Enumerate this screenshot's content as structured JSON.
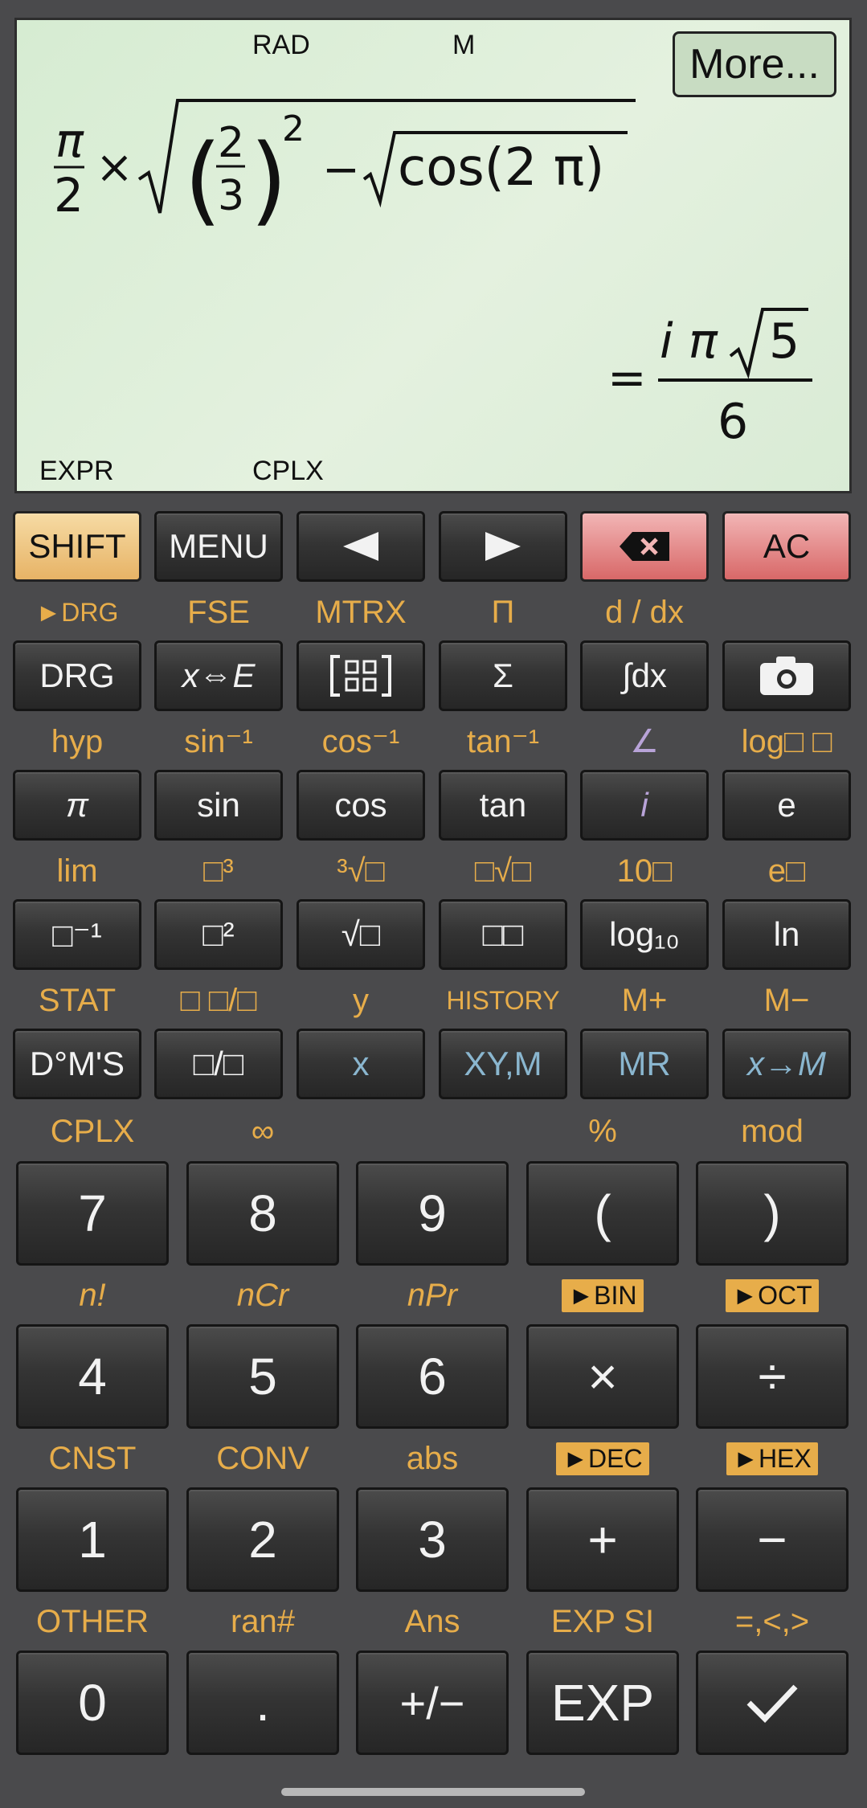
{
  "display": {
    "indicators": {
      "rad": "RAD",
      "m": "M",
      "expr": "EXPR",
      "cplx": "CPLX"
    },
    "more_button": "More...",
    "expression": {
      "pi": "π",
      "two": "2",
      "times": "×",
      "two_num": "2",
      "three_den": "3",
      "exponent": "2",
      "minus": "−",
      "cos_text": "cos(2 π)"
    },
    "result": {
      "equals": "=",
      "numerator": "i π",
      "radicand": "5",
      "denominator": "6"
    }
  },
  "keys": {
    "row1": [
      "SHIFT",
      "MENU",
      "◀",
      "▶",
      "⌫",
      "AC"
    ],
    "row1_icons": [
      "",
      "",
      "left-arrow-icon",
      "right-arrow-icon",
      "backspace-icon",
      ""
    ],
    "row2": [
      "DRG",
      "x⇔E",
      "[⊞]",
      "Σ",
      "∫dx",
      "📷"
    ],
    "row3": [
      "π",
      "sin",
      "cos",
      "tan",
      "i",
      "e"
    ],
    "row4": [
      "□⁻¹",
      "□²",
      "√□",
      "□□",
      "log₁₀",
      "ln"
    ],
    "row5": [
      "D°M'S",
      "□/□",
      "x",
      "XY,M",
      "MR",
      "x→M"
    ],
    "row6": [
      "7",
      "8",
      "9",
      "(",
      ")"
    ],
    "row7": [
      "4",
      "5",
      "6",
      "×",
      "÷"
    ],
    "row8": [
      "1",
      "2",
      "3",
      "+",
      "−"
    ],
    "row9": [
      "0",
      ".",
      "+/−",
      "EXP",
      "✓"
    ]
  },
  "labels": {
    "row2": [
      "►DRG",
      "FSE",
      "MTRX",
      "Π",
      "d / dx",
      ""
    ],
    "row3": [
      "hyp",
      "sin⁻¹",
      "cos⁻¹",
      "tan⁻¹",
      "∠",
      "log□ □"
    ],
    "row4": [
      "lim",
      "□³",
      "³√□",
      "□√□",
      "10□",
      "e□"
    ],
    "row5": [
      "STAT",
      "□ □/□",
      "y",
      "HISTORY",
      "M+",
      "M−"
    ],
    "row6": [
      "CPLX",
      "∞",
      "",
      "%",
      "mod"
    ],
    "row7": [
      "n!",
      "nCr",
      "nPr",
      "►BIN",
      "►OCT"
    ],
    "row8": [
      "CNST",
      "CONV",
      "abs",
      "►DEC",
      "►HEX"
    ],
    "row9": [
      "OTHER",
      "ran#",
      "Ans",
      "EXP SI",
      "=,<,>"
    ]
  },
  "colors": {
    "accent": "#e7ad4a",
    "display_bg": "#dcedd7",
    "body": "#4a4a4c",
    "shift": "#f0c884",
    "ac": "#e58a8a",
    "blue_key_text": "#8ab6cf"
  }
}
